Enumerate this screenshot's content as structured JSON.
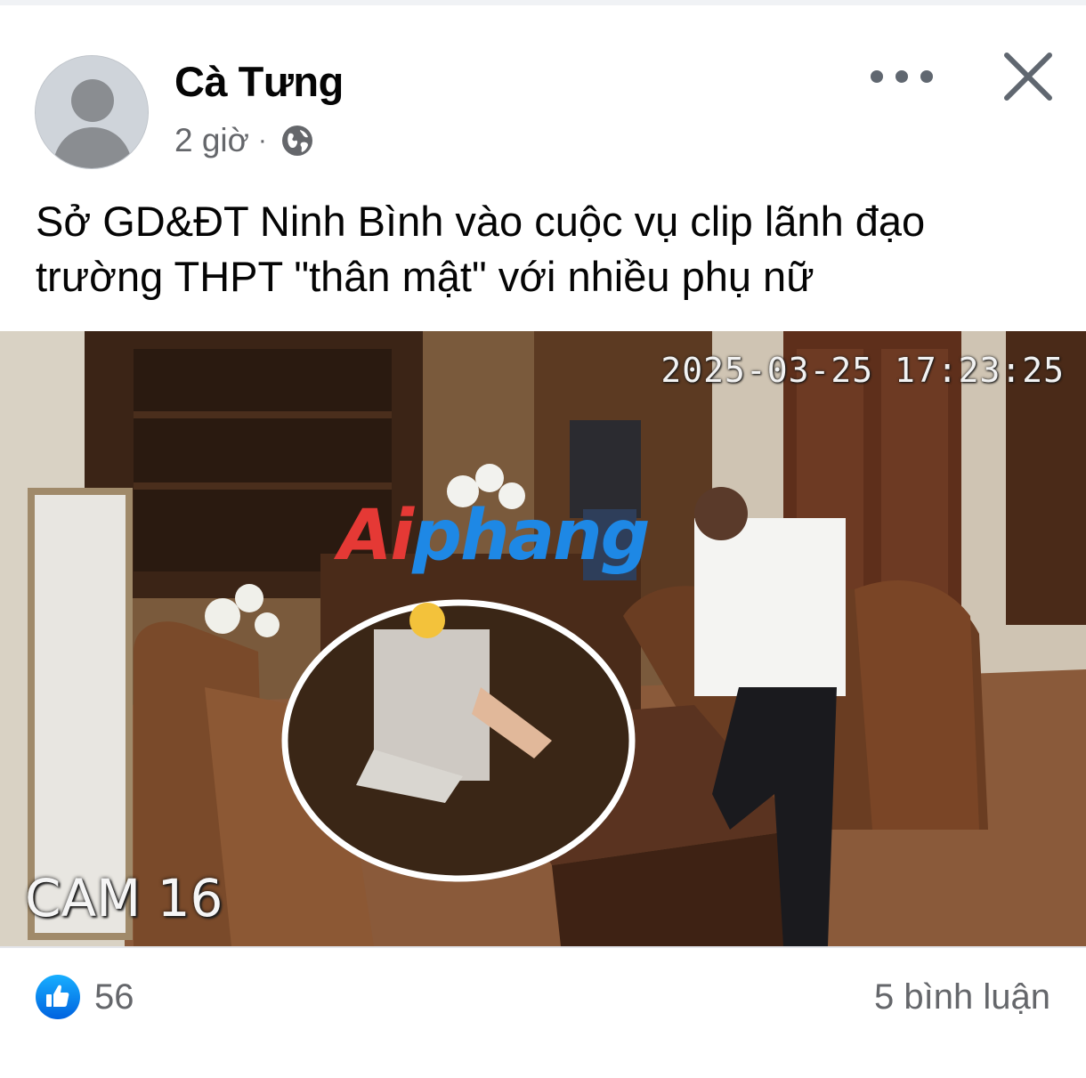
{
  "post": {
    "author": "Cà Tưng",
    "time": "2 giờ",
    "separator": "·",
    "privacy_icon": "globe-icon",
    "text": "Sở GD&ĐT Ninh Bình vào cuộc vụ clip lãnh đạo trường THPT \"thân mật\" với nhiều phụ nữ"
  },
  "media": {
    "timestamp": "2025-03-25 17:23:25",
    "camera_label": "CAM 16",
    "watermark_part_a": "Ai",
    "watermark_part_b": "phang"
  },
  "footer": {
    "like_count": "56",
    "comments": "5 bình luận"
  },
  "icons": {
    "more": "more-icon",
    "close": "close-icon",
    "like": "like-icon",
    "avatar": "avatar"
  },
  "colors": {
    "like_blue": "#1877f2",
    "meta_gray": "#65676b"
  }
}
